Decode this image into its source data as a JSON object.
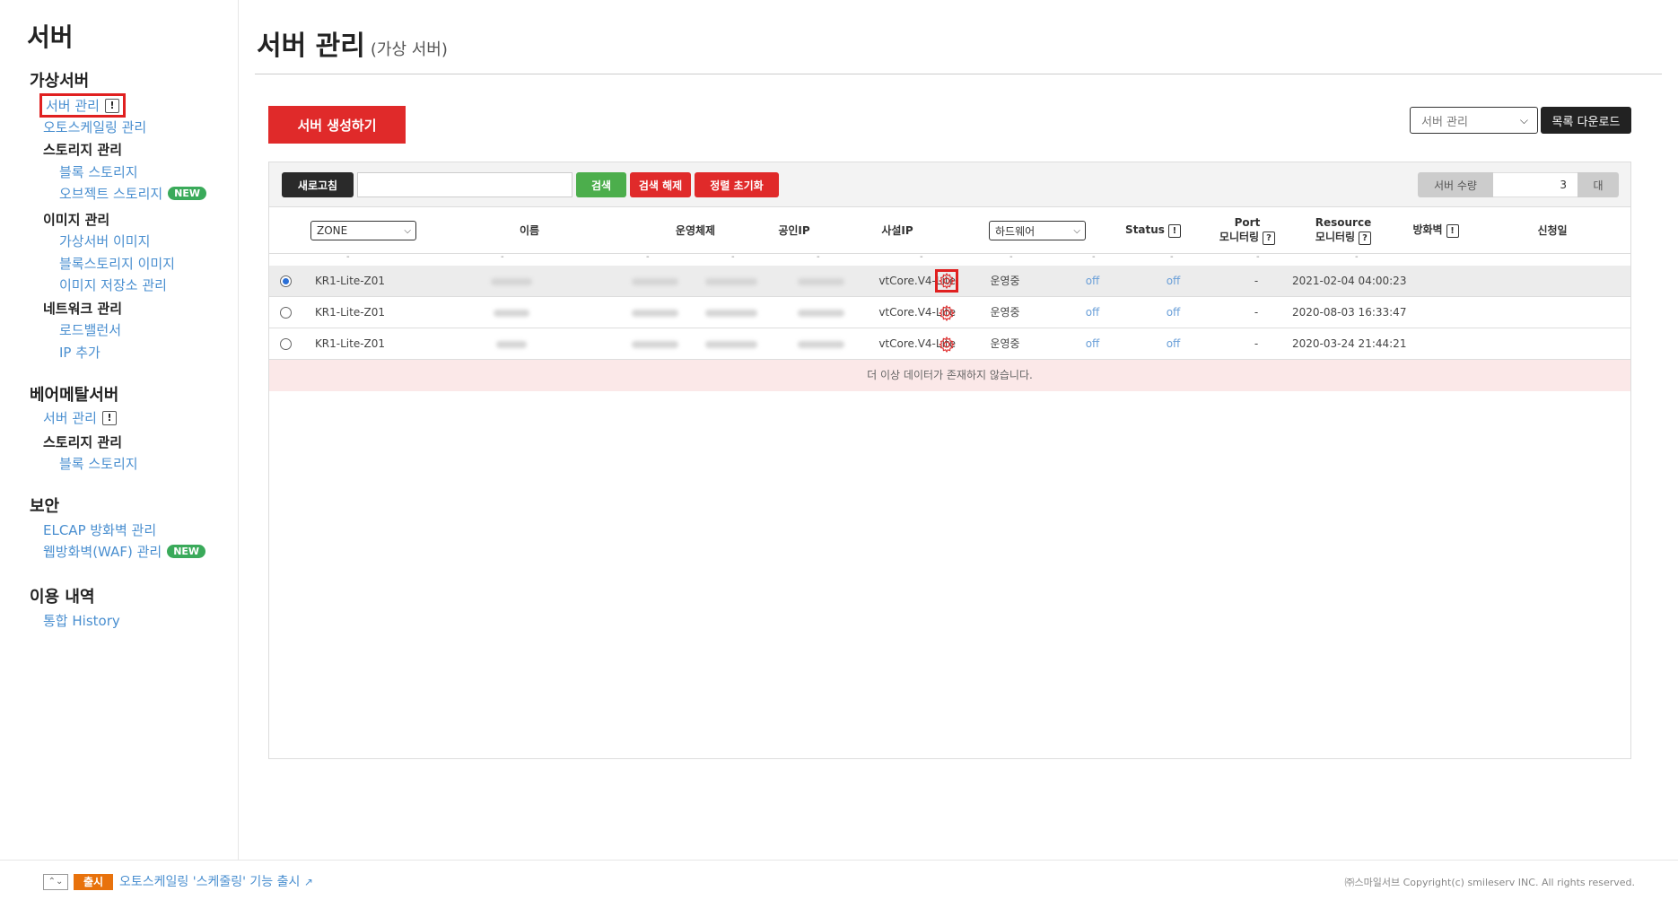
{
  "sidebar": {
    "title": "서버",
    "sections": [
      {
        "label": "가상서버"
      },
      {
        "label": "베어메탈서버"
      },
      {
        "label": "보안"
      },
      {
        "label": "이용 내역"
      }
    ],
    "virtual": {
      "server_mgmt": "서버 관리",
      "autoscaling": "오토스케일링 관리",
      "storage_mgmt": "스토리지 관리",
      "block_storage": "블록 스토리지",
      "object_storage": "오브젝트 스토리지",
      "image_mgmt": "이미지 관리",
      "vm_image": "가상서버 이미지",
      "block_image": "블록스토리지 이미지",
      "image_store": "이미지 저장소 관리",
      "network_mgmt": "네트워크 관리",
      "loadbalancer": "로드밸런서",
      "ip_add": "IP 추가"
    },
    "baremetal": {
      "server_mgmt": "서버 관리",
      "storage_mgmt": "스토리지 관리",
      "block_storage": "블록 스토리지"
    },
    "security": {
      "elcap": "ELCAP 방화벽 관리",
      "waf": "웹방화벽(WAF) 관리"
    },
    "history": {
      "integrated": "통합 History"
    },
    "new_badge": "NEW",
    "excl": "!"
  },
  "header": {
    "title": "서버 관리",
    "subtitle": "(가상 서버)",
    "create_button": "서버 생성하기",
    "select_value": "서버 관리",
    "download_button": "목록 다운로드"
  },
  "toolbar": {
    "refresh": "새로고침",
    "search": "검색",
    "search_clear": "검색 해제",
    "sort_reset": "정렬 초기화",
    "count_label": "서버 수량",
    "count_value": "3",
    "count_unit": "대"
  },
  "table": {
    "headers": {
      "zone": "ZONE",
      "name": "이름",
      "os": "운영체제",
      "public_ip": "공인IP",
      "private_ip": "사설IP",
      "hardware": "하드웨어",
      "status": "Status",
      "port_mon_1": "Port",
      "port_mon_2": "모니터링",
      "res_mon_1": "Resource",
      "res_mon_2": "모니터링",
      "firewall": "방화벽",
      "date": "신청일"
    },
    "dash": "-",
    "rows": [
      {
        "zone": "KR1-Lite-Z01",
        "hardware": "vtCore.V4-Lite",
        "status": "운영중",
        "port": "off",
        "resource": "off",
        "firewall": "-",
        "date": "2021-02-04 04:00:23",
        "selected": true
      },
      {
        "zone": "KR1-Lite-Z01",
        "hardware": "vtCore.V4-Lite",
        "status": "운영중",
        "port": "off",
        "resource": "off",
        "firewall": "-",
        "date": "2020-08-03 16:33:47",
        "selected": false
      },
      {
        "zone": "KR1-Lite-Z01",
        "hardware": "vtCore.V4-Lite",
        "status": "운영중",
        "port": "off",
        "resource": "off",
        "firewall": "-",
        "date": "2020-03-24 21:44:21",
        "selected": false
      }
    ],
    "no_more": "더 이상 데이터가 존재하지 않습니다."
  },
  "footer": {
    "badge": "출시",
    "news": "오토스케일링 '스케줄링' 기능 출시",
    "copyright": "㈜스마일서브 Copyright(c) smileserv INC. All rights reserved."
  },
  "colors": {
    "accent_red": "#e02a2a",
    "link_blue": "#4a8fd0",
    "green": "#3aaa5a",
    "badge_orange": "#e8720c"
  }
}
